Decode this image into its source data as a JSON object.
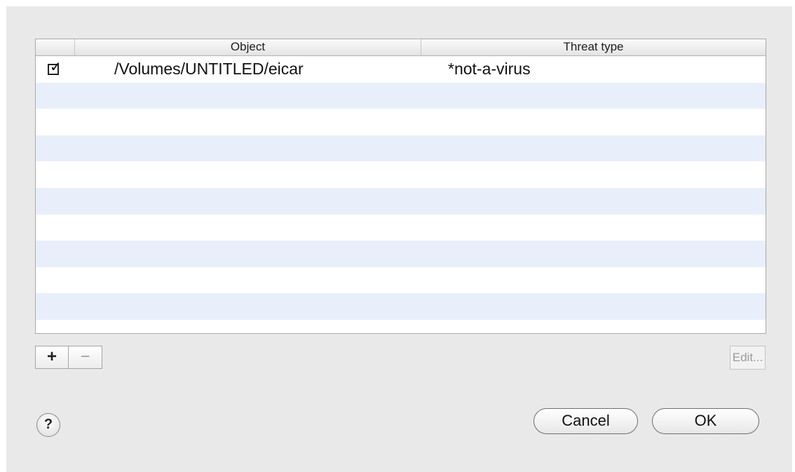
{
  "table": {
    "columns": [
      "",
      "Object",
      "Threat type"
    ],
    "rows": [
      {
        "checked": true,
        "object": "/Volumes/UNTITLED/eicar",
        "threat_type": "*not-a-virus"
      }
    ]
  },
  "toolbar": {
    "add_label": "+",
    "remove_label": "−",
    "edit_label": "Edit..."
  },
  "footer": {
    "help_label": "?",
    "cancel_label": "Cancel",
    "ok_label": "OK"
  },
  "colors": {
    "stripe": "#e9effa",
    "background": "#e9e9e9"
  }
}
